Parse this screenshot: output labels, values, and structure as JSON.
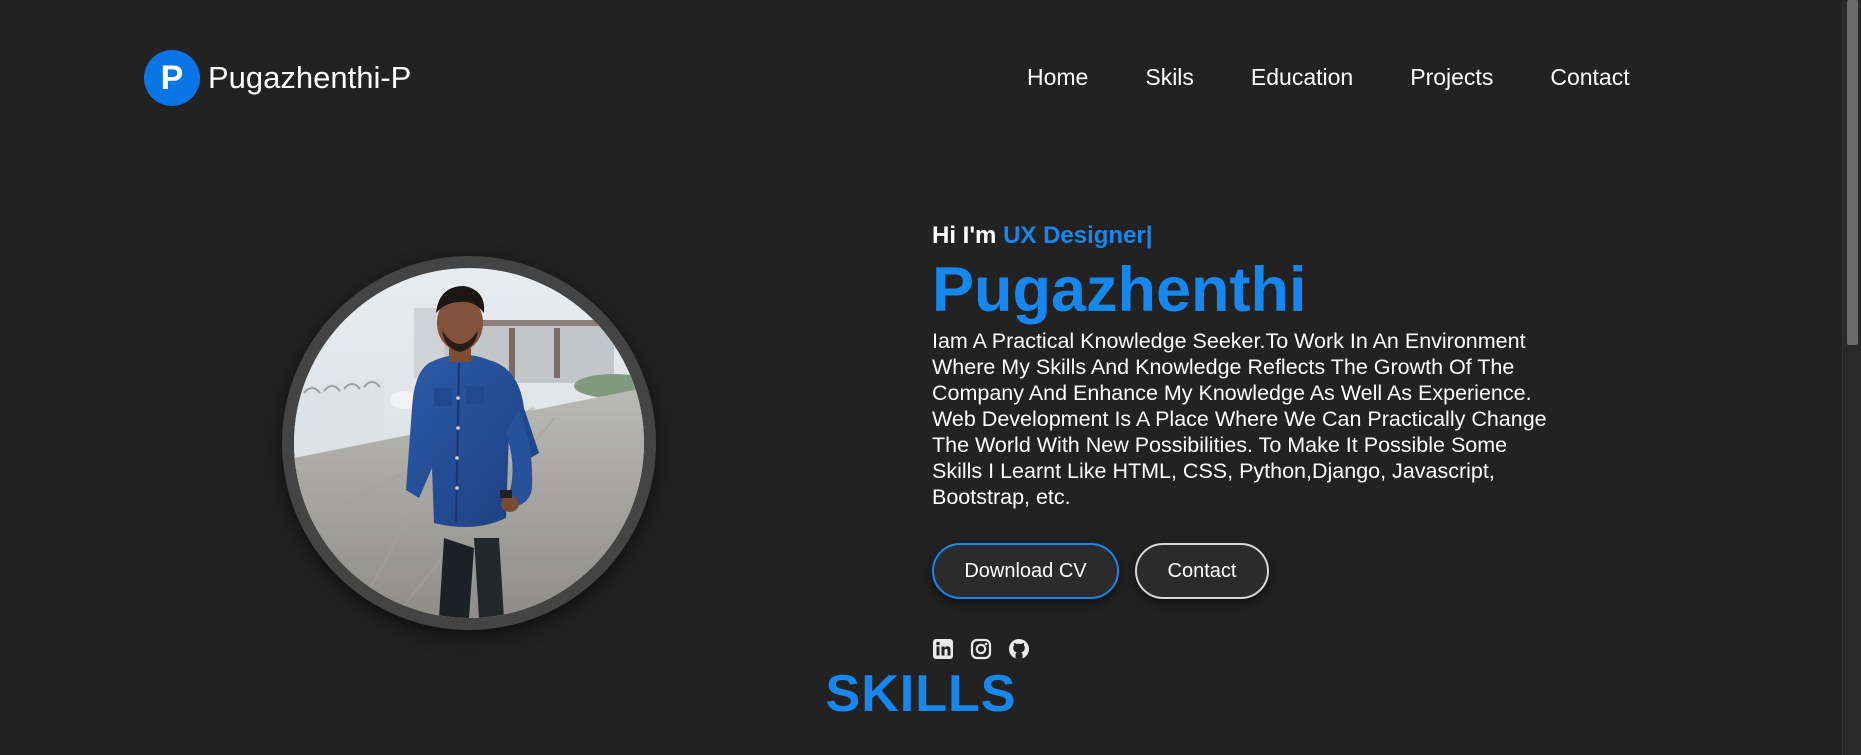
{
  "brand": {
    "logo_letter": "P",
    "name": "Pugazhenthi-P"
  },
  "nav": {
    "items": [
      {
        "label": "Home"
      },
      {
        "label": "Skils"
      },
      {
        "label": "Education"
      },
      {
        "label": "Projects"
      },
      {
        "label": "Contact"
      }
    ]
  },
  "hero": {
    "greeting": "Hi I'm ",
    "role": "UX Designer|",
    "name": "Pugazhenthi",
    "bio": "Iam A Practical Knowledge Seeker.To Work In An Environment Where My Skills And Knowledge Reflects The Growth Of The Company And Enhance My Knowledge As Well As Experience. Web Development Is A Place Where We Can Practically Change The World With New Possibilities. To Make It Possible Some Skills I Learnt Like HTML, CSS, Python,Django, Javascript, Bootstrap, etc.",
    "buttons": {
      "download_cv": "Download CV",
      "contact": "Contact"
    },
    "socials": [
      "linkedin-icon",
      "instagram-icon",
      "github-icon"
    ]
  },
  "sections": {
    "skills_title": "SKILLS"
  },
  "colors": {
    "accent": "#1787f0",
    "background": "#222222",
    "logo_bg": "#0a76e6"
  }
}
